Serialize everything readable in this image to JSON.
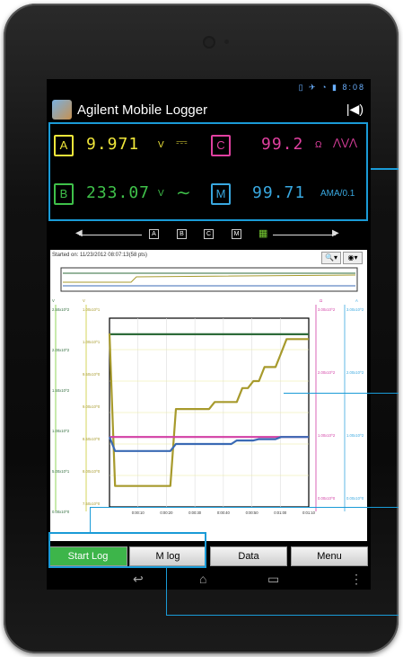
{
  "app": {
    "title": "Agilent Mobile Logger",
    "time": "8:08"
  },
  "meters": [
    {
      "id": "A",
      "value": "9.971",
      "unit": "V",
      "symbol": "⎓",
      "color": "#f0e63a"
    },
    {
      "id": "C",
      "value": "99.2",
      "unit": "Ω",
      "symbol": "⋀⋁⋀",
      "color": "#e040a0"
    },
    {
      "id": "B",
      "value": "233.07",
      "unit": "V",
      "symbol": "∼",
      "color": "#3fc14a"
    },
    {
      "id": "M",
      "value": "99.71",
      "unit": "AMA/0.1",
      "symbol": "",
      "color": "#39a8e0"
    }
  ],
  "nav_chips": [
    "A",
    "B",
    "C",
    "M"
  ],
  "plot": {
    "started": "Started on: 11/23/2012 08:07:13(58 pts)",
    "left_ticks": [
      "2.50x10^2",
      "2.00x10^2",
      "1.50x10^2",
      "1.00x10^2",
      "5.00x10^1",
      "0.00x10^0"
    ],
    "inner_ticks": [
      "1.00x10^1",
      "1.00x10^1",
      "9.50x10^0",
      "9.00x10^0",
      "8.50x10^0",
      "8.00x10^0",
      "7.50x10^0"
    ],
    "right_ticks_pink": [
      "3.00x10^2",
      "2.00x10^2",
      "1.00x10^2",
      "0.00x10^0"
    ],
    "right_ticks_cyan": [
      "3.00x10^2",
      "2.00x10^2",
      "1.00x10^2",
      "0.00x10^0"
    ],
    "x_ticks": [
      "0:00:10",
      "0:00:20",
      "0:00:30",
      "0:00:40",
      "0:00:50",
      "0:01:00",
      "0:01:10"
    ],
    "axis_letters": {
      "left": "V",
      "inner": "V",
      "pink": "Ω",
      "cyan": "A"
    }
  },
  "chart_data": {
    "type": "line",
    "x": [
      0,
      2,
      4,
      6,
      8,
      10,
      12,
      14,
      16,
      18,
      20,
      22,
      24,
      26,
      28,
      30,
      32,
      34,
      36,
      38,
      40,
      42,
      44,
      46,
      48,
      50,
      52,
      54,
      56,
      58,
      60,
      62,
      64,
      66,
      68,
      70,
      72
    ],
    "series": [
      {
        "values": [
          9.97,
          9.97,
          9.97,
          9.97,
          9.97,
          9.97,
          9.97,
          9.97,
          9.97,
          9.97,
          9.97,
          9.97,
          9.97,
          9.97,
          9.97,
          9.97,
          9.97,
          9.97,
          9.97,
          9.97,
          9.97,
          9.97,
          9.97,
          9.97,
          9.97,
          9.97,
          9.97,
          9.97,
          9.97,
          9.97,
          9.97,
          9.97,
          9.97,
          9.97,
          9.97,
          9.97,
          9.97
        ]
      },
      {
        "values": [
          9.98,
          7.8,
          7.8,
          7.8,
          7.8,
          7.8,
          7.8,
          7.8,
          7.8,
          7.8,
          7.8,
          7.8,
          8.9,
          8.9,
          8.9,
          8.9,
          8.9,
          8.9,
          8.9,
          9.0,
          9.0,
          9.0,
          9.0,
          9.0,
          9.2,
          9.2,
          9.3,
          9.3,
          9.5,
          9.5,
          9.5,
          9.7,
          9.9,
          9.9,
          9.9,
          9.9,
          9.9
        ]
      },
      {
        "values": [
          8.5,
          8.5,
          8.5,
          8.5,
          8.5,
          8.5,
          8.5,
          8.5,
          8.5,
          8.5,
          8.5,
          8.5,
          8.5,
          8.5,
          8.5,
          8.5,
          8.5,
          8.5,
          8.5,
          8.5,
          8.5,
          8.5,
          8.5,
          8.5,
          8.5,
          8.5,
          8.5,
          8.5,
          8.5,
          8.5,
          8.5,
          8.5,
          8.5,
          8.5,
          8.5,
          8.5,
          8.5
        ]
      },
      {
        "values": [
          8.5,
          8.3,
          8.3,
          8.3,
          8.3,
          8.3,
          8.3,
          8.3,
          8.3,
          8.3,
          8.3,
          8.3,
          8.4,
          8.4,
          8.4,
          8.4,
          8.4,
          8.4,
          8.4,
          8.4,
          8.4,
          8.4,
          8.4,
          8.45,
          8.45,
          8.45,
          8.45,
          8.47,
          8.47,
          8.47,
          8.47,
          8.5,
          8.5,
          8.5,
          8.5,
          8.5,
          8.5
        ]
      }
    ],
    "colors": [
      "#2e6b3a",
      "#a79a2c",
      "#d23fa5",
      "#3a6ab4"
    ],
    "ylim": [
      7.5,
      10.2
    ]
  },
  "buttons": {
    "start": "Start Log",
    "mlog": "M log",
    "data": "Data",
    "menu": "Menu"
  }
}
